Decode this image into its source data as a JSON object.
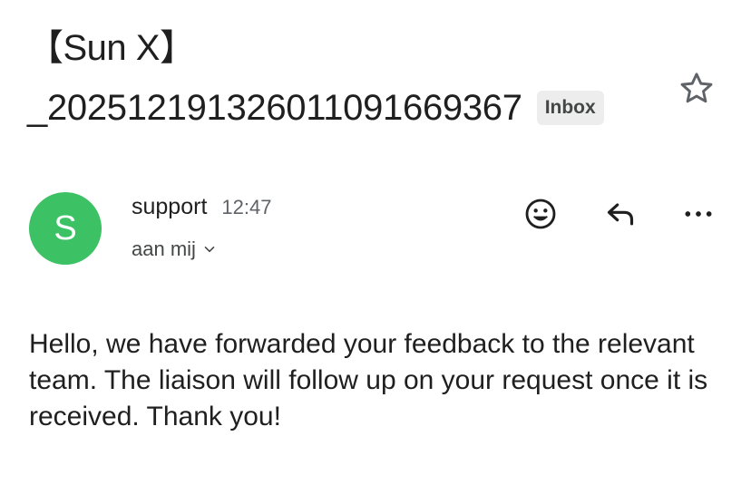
{
  "email": {
    "subject_line1": "【Sun X】",
    "subject_line2": "_20251219132601109166​9367",
    "label": "Inbox",
    "sender": {
      "avatar_letter": "S",
      "name": "support",
      "time": "12:47",
      "recipient": "aan mij"
    },
    "body": "Hello, we have forwarded your feedback to the relevant team. The liaison will follow up on your request once it is received. Thank you!"
  },
  "icons": {
    "star": "star-outline-icon",
    "emoji": "add-reaction-icon",
    "reply": "reply-icon",
    "more": "more-horizontal-icon",
    "chevron": "chevron-down-icon"
  },
  "colors": {
    "avatar": "#3cc164",
    "label_bg": "#ededed"
  }
}
